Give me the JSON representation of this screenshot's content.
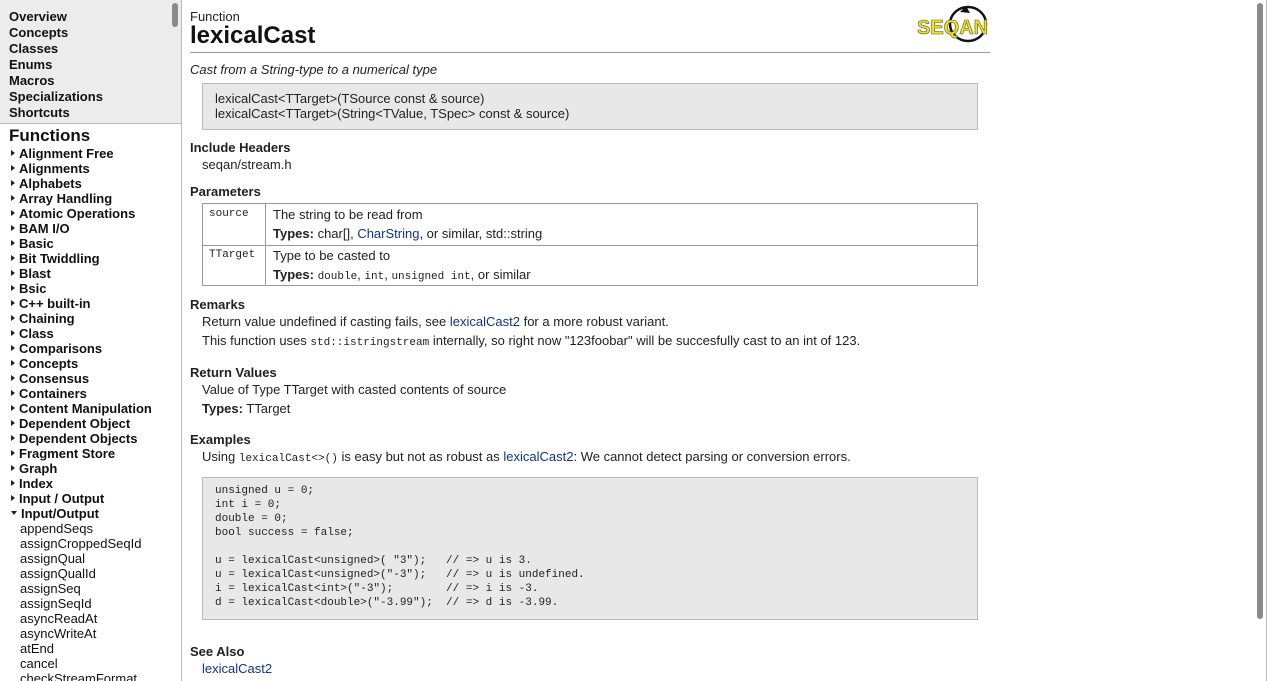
{
  "nav": {
    "top_links": [
      "Overview",
      "Concepts",
      "Classes",
      "Enums",
      "Macros",
      "Specializations",
      "Shortcuts"
    ],
    "functions_heading": "Functions",
    "categories": [
      "Alignment Free",
      "Alignments",
      "Alphabets",
      "Array Handling",
      "Atomic Operations",
      "BAM I/O",
      "Basic",
      "Bit Twiddling",
      "Blast",
      "Bsic",
      "C++ built-in",
      "Chaining",
      "Class",
      "Comparisons",
      "Concepts",
      "Consensus",
      "Containers",
      "Content Manipulation",
      "Dependent Object",
      "Dependent Objects",
      "Fragment Store",
      "Graph",
      "Index",
      "Input / Output"
    ],
    "expanded_category": "Input/Output",
    "expanded_items": [
      "appendSeqs",
      "assignCroppedSeqId",
      "assignQual",
      "assignQualId",
      "assignSeq",
      "assignSeqId",
      "asyncReadAt",
      "asyncWriteAt",
      "atEnd",
      "cancel",
      "checkStreamFormat"
    ]
  },
  "page": {
    "kind": "Function",
    "title": "lexicalCast",
    "logo_text": "SEQAN",
    "summary": "Cast from a String-type to a numerical type",
    "signatures": [
      "lexicalCast<TTarget>(TSource const & source)",
      "lexicalCast<TTarget>(String<TValue, TSpec> const & source)"
    ]
  },
  "include": {
    "heading": "Include Headers",
    "value": "seqan/stream.h"
  },
  "params": {
    "heading": "Parameters",
    "types_label": "Types:",
    "rows": [
      {
        "name": "source",
        "desc": "The string to be read from",
        "types": [
          {
            "text": "char[]",
            "style": "plain"
          },
          {
            "text": ", ",
            "style": "plain"
          },
          {
            "text": "CharString",
            "style": "link"
          },
          {
            "text": ", or similar, std::string",
            "style": "plain"
          }
        ]
      },
      {
        "name": "TTarget",
        "desc": "Type to be casted to",
        "types": [
          {
            "text": "double",
            "style": "mono"
          },
          {
            "text": ", ",
            "style": "plain"
          },
          {
            "text": "int",
            "style": "mono"
          },
          {
            "text": ", ",
            "style": "plain"
          },
          {
            "text": "unsigned int",
            "style": "mono"
          },
          {
            "text": ", or similar",
            "style": "plain"
          }
        ]
      }
    ]
  },
  "remarks": {
    "heading": "Remarks",
    "line1_pre": "Return value undefined if casting fails, see ",
    "line1_link": "lexicalCast2",
    "line1_post": " for a more robust variant.",
    "line2_pre": "This function uses ",
    "line2_code": "std::istringstream",
    "line2_post": " internally, so right now \"123foobar\" will be succesfully cast to an int of 123."
  },
  "returns": {
    "heading": "Return Values",
    "line1": "Value of Type TTarget with casted contents of source",
    "types_label": "Types:",
    "types_value": "TTarget"
  },
  "examples": {
    "heading": "Examples",
    "intro_pre": "Using ",
    "intro_code": "lexicalCast<>()",
    "intro_mid": " is easy but not as robust as ",
    "intro_link": "lexicalCast2",
    "intro_post": ": We cannot detect parsing or conversion errors.",
    "code": [
      "unsigned u = 0;",
      "int i = 0;",
      "double = 0;",
      "bool success = false;",
      "",
      "u = lexicalCast<unsigned>( \"3\");   // => u is 3.",
      "u = lexicalCast<unsigned>(\"-3\");   // => u is undefined.",
      "i = lexicalCast<int>(\"-3\");        // => i is -3.",
      "d = lexicalCast<double>(\"-3.99\");  // => d is -3.99."
    ]
  },
  "see_also": {
    "heading": "See Also",
    "link": "lexicalCast2"
  },
  "colors": {
    "link": "#11338a",
    "logo_yellow": "#f2e600",
    "code_bg": "#e8e8e8",
    "nav_bg": "#ececec"
  }
}
